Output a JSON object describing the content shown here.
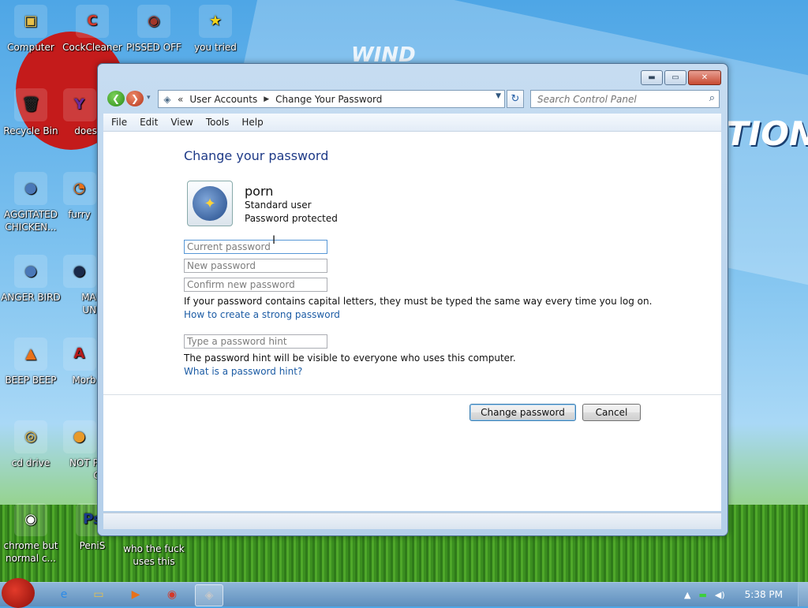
{
  "desktop": {
    "background_text": "TION",
    "background_text_top": "WIND",
    "icons": [
      {
        "label": "Computer",
        "glyph": "▣",
        "color": "#e8c04a"
      },
      {
        "label": "CockCleaner",
        "glyph": "C",
        "color": "#d3382a"
      },
      {
        "label": "PISSED OFF",
        "glyph": "◉",
        "color": "#a3362a"
      },
      {
        "label": "you tried",
        "glyph": "★",
        "color": "#f2d21a"
      },
      {
        "label": "Recycle Bin",
        "glyph": "🗑",
        "color": "#222"
      },
      {
        "label": "does work",
        "glyph": "Y",
        "color": "#6b2b9a"
      },
      {
        "label": "AGGITATED CHICKEN...",
        "glyph": "●",
        "color": "#4a78b8"
      },
      {
        "label": "furry",
        "glyph": "◔",
        "color": "#e8711a"
      },
      {
        "label": "ANGER BIRD",
        "glyph": "●",
        "color": "#4a78b8"
      },
      {
        "label": "MAD B UNIVE",
        "glyph": "●",
        "color": "#1a2a4a"
      },
      {
        "label": "BEEP BEEP",
        "glyph": "▲",
        "color": "#e8711a"
      },
      {
        "label": "Morb Reac",
        "glyph": "A",
        "color": "#b81a1a"
      },
      {
        "label": "cd drive",
        "glyph": "◎",
        "color": "#e8c04a"
      },
      {
        "label": "NOT P BIRD G",
        "glyph": "●",
        "color": "#e89a2a"
      },
      {
        "label": "chrome but normal c...",
        "glyph": "◉",
        "color": "#fff"
      },
      {
        "label": "PeniS",
        "glyph": "Ps",
        "color": "#1a3a8a"
      },
      {
        "label": "who the fuck uses this",
        "glyph": "",
        "color": "transparent"
      }
    ]
  },
  "window": {
    "controls": {
      "minimize": "▬",
      "maximize": "▭",
      "close": "✕"
    },
    "nav": {
      "back": "❮",
      "forward": "❯",
      "dropdown": "▾"
    },
    "address": {
      "icon": "◈",
      "chevron": "«",
      "segments": [
        "User Accounts",
        "Change Your Password"
      ],
      "separator": "▶",
      "dropdown": "▼"
    },
    "refresh_icon": "↻",
    "search": {
      "placeholder": "Search Control Panel",
      "icon": "⌕"
    },
    "menu": [
      "File",
      "Edit",
      "View",
      "Tools",
      "Help"
    ]
  },
  "content": {
    "title": "Change your password",
    "user": {
      "name": "porn",
      "type": "Standard user",
      "protection": "Password protected",
      "avatar_glyph": "✦"
    },
    "fields": {
      "current": "Current password",
      "new": "New password",
      "confirm": "Confirm new password",
      "hint": "Type a password hint"
    },
    "caps_note": "If your password contains capital letters, they must be typed the same way every time you log on.",
    "strong_link": "How to create a strong password",
    "hint_note": "The password hint will be visible to everyone who uses this computer.",
    "hint_link": "What is a password hint?",
    "buttons": {
      "change": "Change password",
      "cancel": "Cancel"
    },
    "cursor": "I"
  },
  "taskbar": {
    "items": [
      {
        "glyph": "e",
        "color": "#2a8ae8"
      },
      {
        "glyph": "▭",
        "color": "#e8c04a"
      },
      {
        "glyph": "▶",
        "color": "#e8711a"
      },
      {
        "glyph": "◉",
        "color": "#d3382a"
      },
      {
        "glyph": "◈",
        "color": "#c8c8c8"
      }
    ],
    "tray": {
      "up_arrow": "▲",
      "network": "▬",
      "volume": "◀)",
      "time": "5:38 PM"
    }
  }
}
